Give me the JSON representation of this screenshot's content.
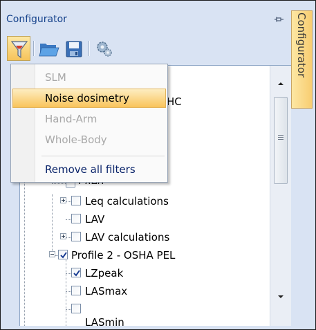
{
  "panel": {
    "title": "Configurator"
  },
  "side_tab": {
    "label": "Configurator"
  },
  "toolbar": {
    "buttons": [
      {
        "icon": "filter-icon",
        "active": true
      },
      {
        "icon": "open-folder-icon"
      },
      {
        "icon": "save-icon"
      },
      {
        "icon": "gears-icon"
      }
    ]
  },
  "filter_menu": {
    "items": [
      {
        "label": "SLM",
        "enabled": false
      },
      {
        "label": "Noise dosimetry",
        "enabled": true,
        "highlighted": true
      },
      {
        "label": "Hand-Arm",
        "enabled": false
      },
      {
        "label": "Whole-Body",
        "enabled": false
      },
      {
        "label": "Remove all filters",
        "enabled": true
      }
    ]
  },
  "tree": {
    "partial_behind_menu": "HC",
    "nodes": [
      {
        "label": "LAeq",
        "checked": false
      },
      {
        "label": "Leq calculations",
        "checked": false
      },
      {
        "label": "LAV",
        "checked": false
      },
      {
        "label": "LAV calculations",
        "checked": false
      },
      {
        "label": "Profile 2 - OSHA PEL",
        "checked": true
      },
      {
        "label": "LZpeak",
        "checked": true
      },
      {
        "label": "LASmax",
        "checked": false
      },
      {
        "label": "LASmin",
        "checked": false
      }
    ]
  },
  "colors": {
    "panel_bg": "#d9e3f3",
    "title_text": "#15428b",
    "highlight": "#f9c45b",
    "menu_text": "#0a246a",
    "disabled_text": "#a8a8a8"
  }
}
